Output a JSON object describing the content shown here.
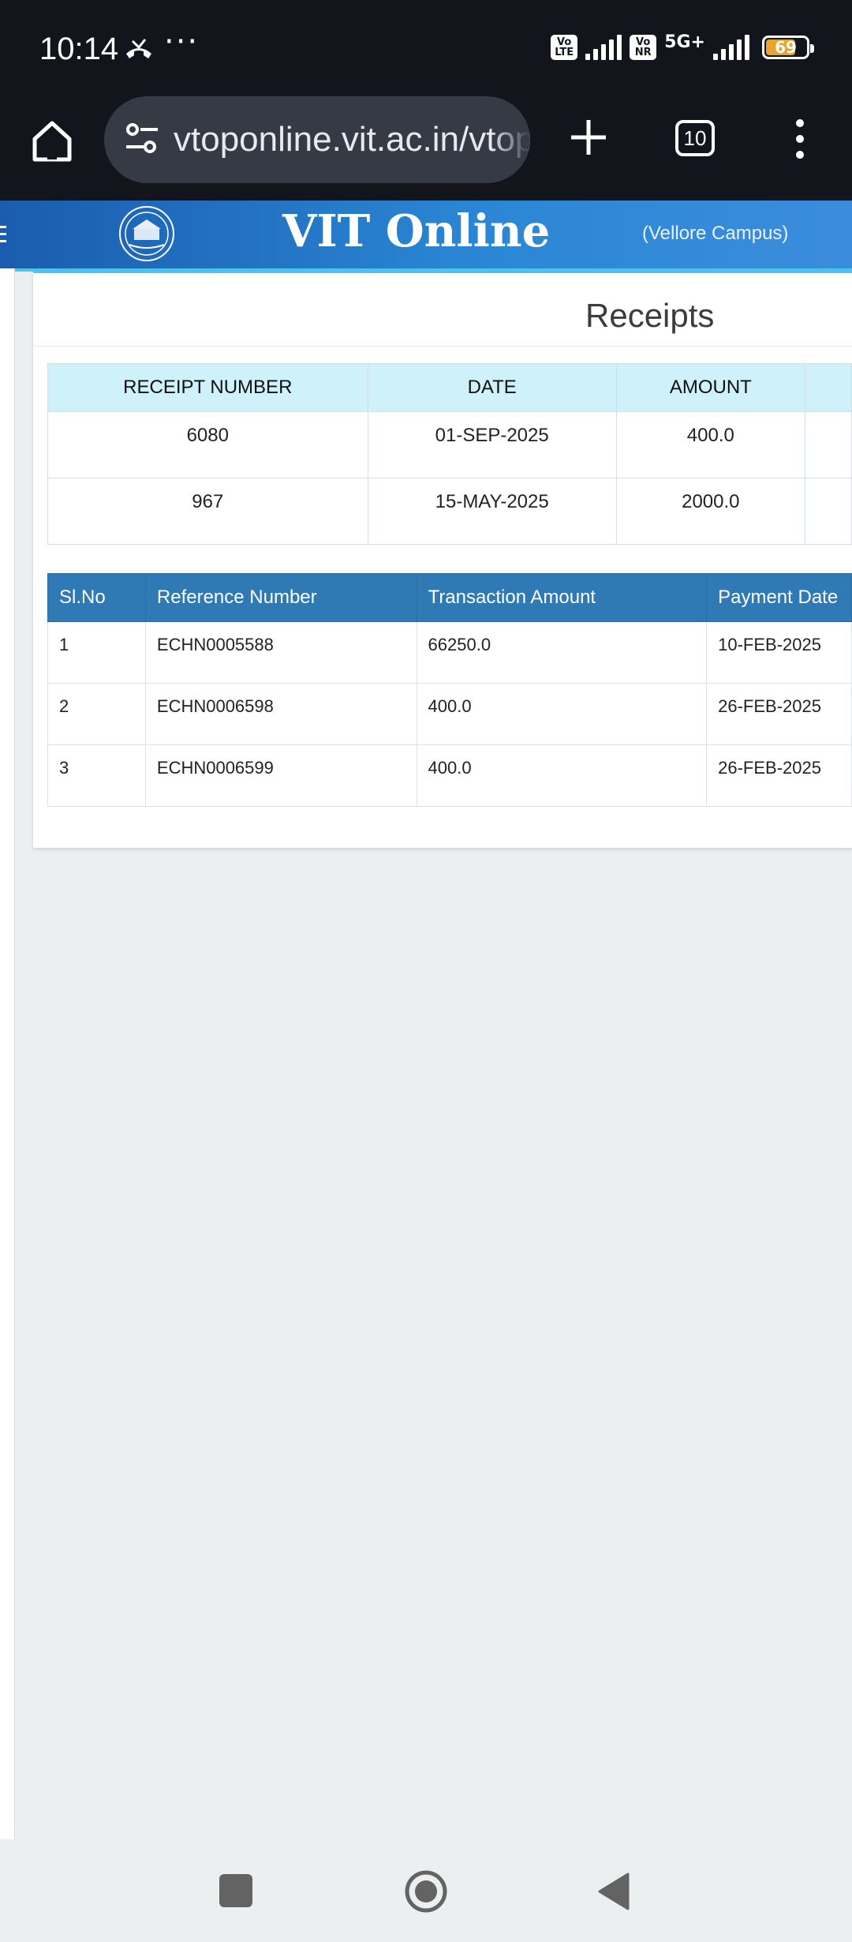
{
  "status_bar": {
    "time": "10:14",
    "more": "···",
    "sim1_badge": "Vo LTE",
    "sim2_badge": "Vo NR",
    "network": "5G+",
    "battery": "69"
  },
  "browser": {
    "url": "vtoponline.vit.ac.in/vtop",
    "tab_count": "10"
  },
  "header": {
    "title": "VIT Online",
    "campus": "(Vellore Campus)"
  },
  "page": {
    "title": "Receipts"
  },
  "receipts": {
    "headers": [
      "RECEIPT NUMBER",
      "DATE",
      "AMOUNT",
      ""
    ],
    "rows": [
      [
        "6080",
        "01-SEP-2025",
        "400.0",
        ""
      ],
      [
        "967",
        "15-MAY-2025",
        "2000.0",
        ""
      ]
    ]
  },
  "transactions": {
    "headers": [
      "Sl.No",
      "Reference Number",
      "Transaction Amount",
      "Payment Date"
    ],
    "rows": [
      [
        "1",
        "ECHN0005588",
        "66250.0",
        "10-FEB-2025"
      ],
      [
        "2",
        "ECHN0006598",
        "400.0",
        "26-FEB-2025"
      ],
      [
        "3",
        "ECHN0006599",
        "400.0",
        "26-FEB-2025"
      ]
    ]
  },
  "colors": {
    "status_bg": "#13151c",
    "header_blue": "#2a86d4",
    "receipts_header": "#cff1fa",
    "transactions_header": "#2f7ab4"
  },
  "icons": {
    "home": "home-icon",
    "tune": "tune-icon",
    "new_tab": "plus-icon",
    "menu": "more-vert-icon",
    "hamburger": "hamburger-icon"
  }
}
